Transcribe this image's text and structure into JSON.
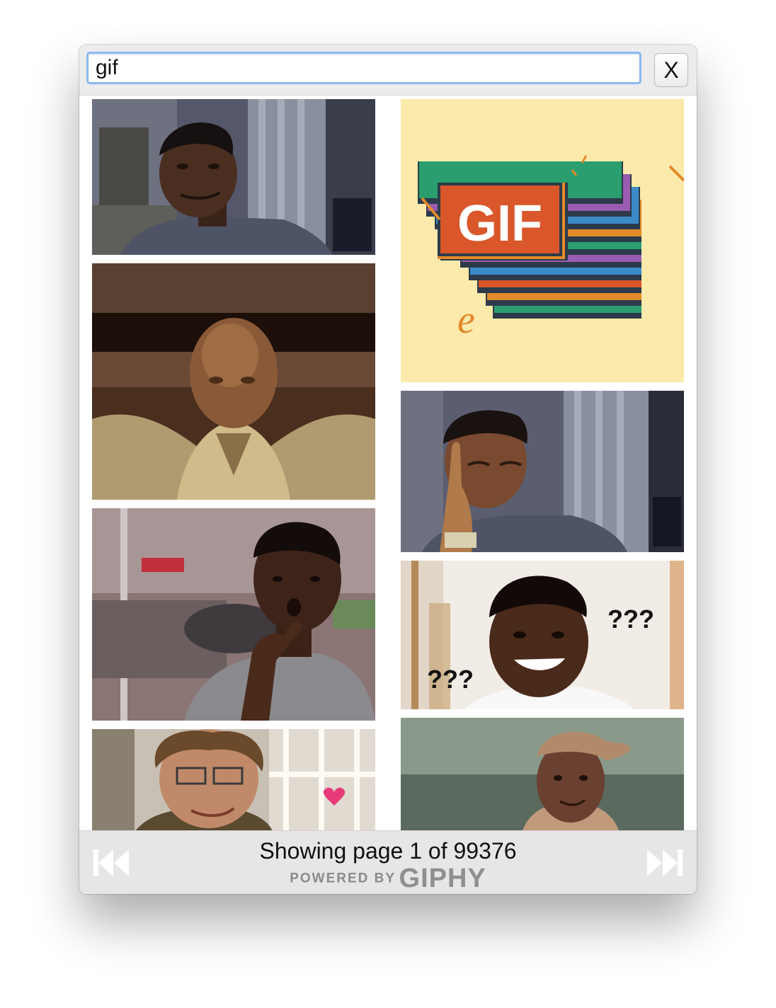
{
  "search": {
    "value": "gif",
    "close_label": "X"
  },
  "results": [
    {
      "id": "gif-1",
      "description": "man smirking in front of building",
      "column": "left"
    },
    {
      "id": "gif-2",
      "description": "bald animated character swaying",
      "column": "left"
    },
    {
      "id": "gif-3",
      "description": "man with hand on chin looking surprised",
      "column": "left"
    },
    {
      "id": "gif-4",
      "description": "man with glasses smiling with pink heart",
      "column": "left"
    },
    {
      "id": "gif-5",
      "description": "GIF logo on stack of colored cards",
      "column": "right",
      "logo_text": "GIF",
      "caption_glyph": "e"
    },
    {
      "id": "gif-6",
      "description": "man pointing to temple",
      "column": "right"
    },
    {
      "id": "gif-7",
      "description": "man smiling with question marks",
      "column": "right",
      "overlay_texts": [
        "???",
        "???"
      ]
    },
    {
      "id": "gif-8",
      "description": "woman in headscarf smiling",
      "column": "right"
    }
  ],
  "footer": {
    "page_status": "Showing page 1 of 99376",
    "powered_by": "POWERED BY",
    "brand": "GIPHY",
    "prev_icon": "skip-back-icon",
    "next_icon": "skip-forward-icon"
  },
  "colors": {
    "focus_ring": "#8ab8f4",
    "footer_bg": "#e7e5e7",
    "nav_icon": "#ffffff",
    "gif_logo_bg": "#fbeaab"
  }
}
